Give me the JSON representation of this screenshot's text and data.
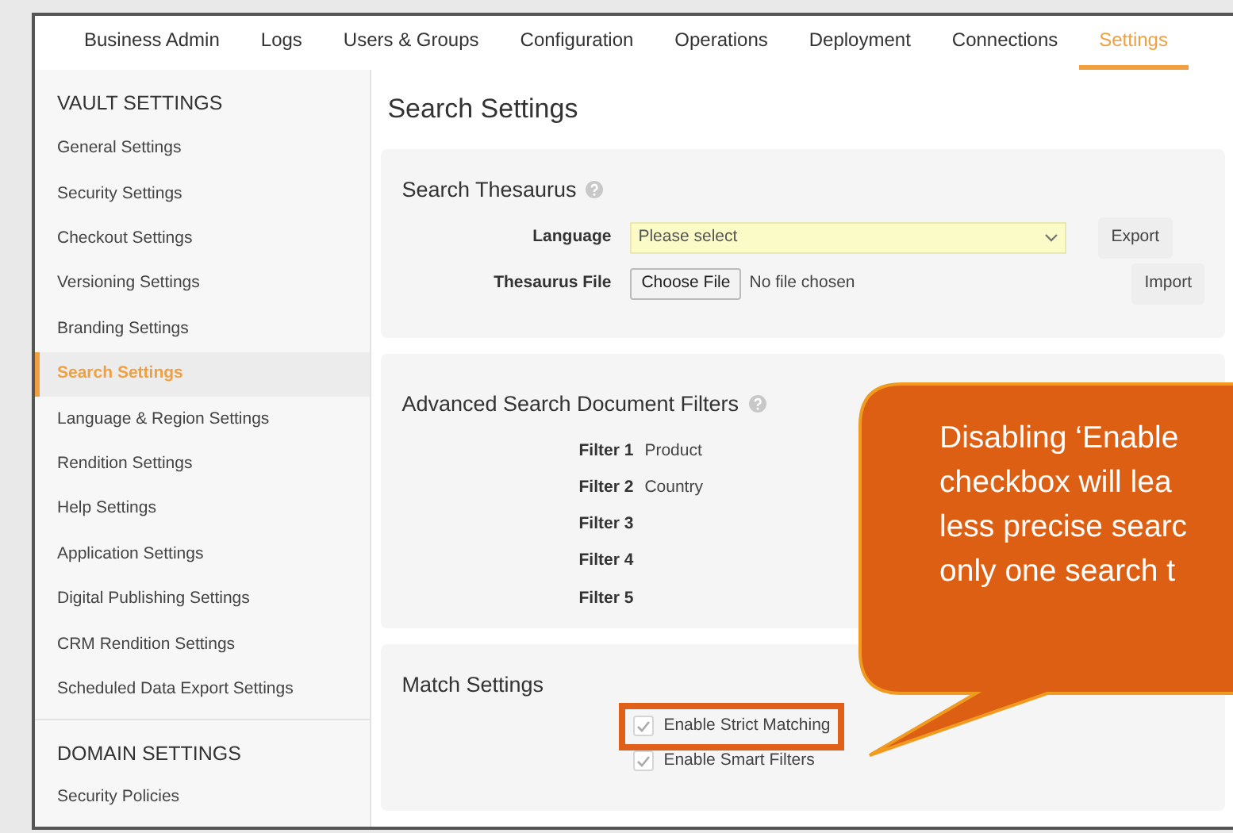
{
  "tabs": [
    {
      "label": "Business Admin",
      "selected": false
    },
    {
      "label": "Logs",
      "selected": false
    },
    {
      "label": "Users & Groups",
      "selected": false
    },
    {
      "label": "Configuration",
      "selected": false
    },
    {
      "label": "Operations",
      "selected": false
    },
    {
      "label": "Deployment",
      "selected": false
    },
    {
      "label": "Connections",
      "selected": false
    },
    {
      "label": "Settings",
      "selected": true
    }
  ],
  "sidebar": {
    "sections": [
      {
        "heading": "VAULT SETTINGS",
        "items": [
          {
            "label": "General Settings",
            "selected": false
          },
          {
            "label": "Security Settings",
            "selected": false
          },
          {
            "label": "Checkout Settings",
            "selected": false
          },
          {
            "label": "Versioning Settings",
            "selected": false
          },
          {
            "label": "Branding Settings",
            "selected": false
          },
          {
            "label": "Search Settings",
            "selected": true
          },
          {
            "label": "Language & Region Settings",
            "selected": false
          },
          {
            "label": "Rendition Settings",
            "selected": false
          },
          {
            "label": "Help Settings",
            "selected": false
          },
          {
            "label": "Application Settings",
            "selected": false
          },
          {
            "label": "Digital Publishing Settings",
            "selected": false
          },
          {
            "label": "CRM Rendition Settings",
            "selected": false
          },
          {
            "label": "Scheduled Data Export Settings",
            "selected": false
          }
        ]
      },
      {
        "heading": "DOMAIN SETTINGS",
        "items": [
          {
            "label": "Security Policies",
            "selected": false
          }
        ]
      }
    ]
  },
  "page_title": "Search Settings",
  "thesaurus": {
    "title": "Search Thesaurus",
    "language_label": "Language",
    "language_placeholder": "Please select",
    "file_label": "Thesaurus File",
    "choose_button": "Choose File",
    "file_status": "No file chosen",
    "export_button": "Export",
    "import_button": "Import"
  },
  "filters": {
    "title": "Advanced Search Document Filters",
    "rows": [
      {
        "label": "Filter 1",
        "value": "Product"
      },
      {
        "label": "Filter 2",
        "value": "Country"
      },
      {
        "label": "Filter 3"
      },
      {
        "label": "Filter 4"
      },
      {
        "label": "Filter 5"
      }
    ]
  },
  "match": {
    "title": "Match Settings",
    "options": [
      {
        "label": "Enable Strict Matching",
        "checked": true,
        "highlighted": true
      },
      {
        "label": "Enable Smart Filters",
        "checked": true,
        "highlighted": false
      }
    ]
  },
  "callout": {
    "lines": [
      "Disabling ‘Enable",
      "checkbox will lea",
      "less precise searc",
      "only one search t"
    ]
  }
}
